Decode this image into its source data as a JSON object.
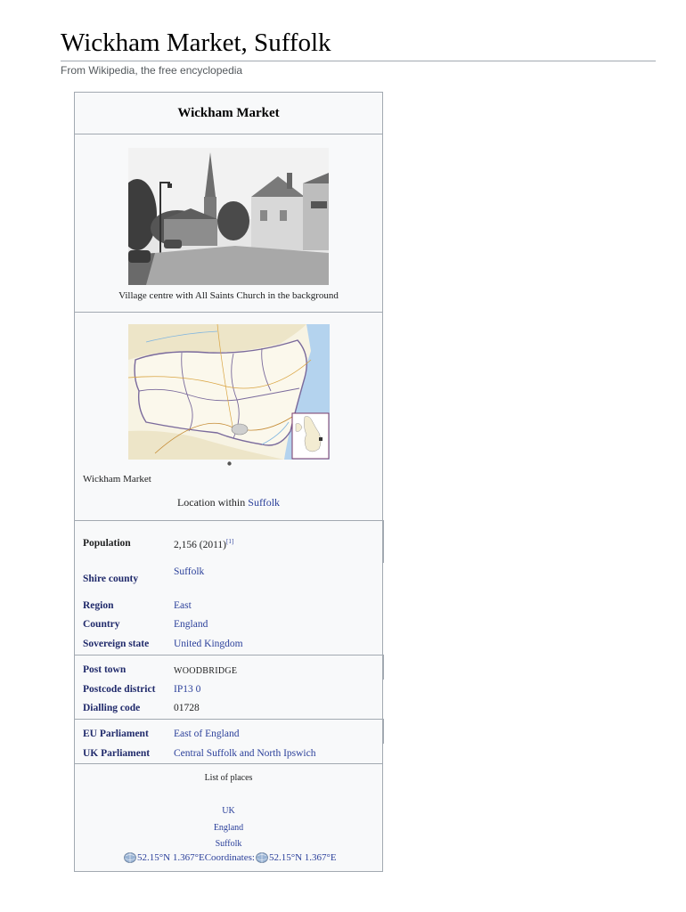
{
  "page": {
    "title": "Wickham Market, Suffolk",
    "tagline": "From Wikipedia, the free encyclopedia"
  },
  "infobox": {
    "title": "Wickham Market",
    "photo_caption": "Village centre with All Saints Church in the background",
    "map_marker_label": "Wickham Market",
    "map_caption_prefix": "Location within ",
    "map_caption_link": "Suffolk",
    "rows": {
      "population_label": "Population",
      "population_value": "2,156 (2011)",
      "population_ref": "[1]",
      "shire_county_label": "Shire county",
      "shire_county_value": "Suffolk",
      "region_label": "Region",
      "region_value": "East",
      "country_label": "Country",
      "country_value": "England",
      "sovereign_state_label": "Sovereign state",
      "sovereign_state_value": "United Kingdom",
      "post_town_label": "Post town",
      "post_town_value": "WOODBRIDGE",
      "postcode_district_label": "Postcode district",
      "postcode_district_value": "IP13 0",
      "dialling_code_label": "Dialling code",
      "dialling_code_value": "01728",
      "eu_parliament_label": "EU Parliament",
      "eu_parliament_value": "East of England",
      "uk_parliament_label": "UK Parliament",
      "uk_parliament_value": "Central Suffolk and North Ipswich"
    },
    "list_of_places": {
      "heading": "List of places",
      "items": [
        "UK",
        "England",
        "Suffolk"
      ]
    },
    "coordinates": {
      "first": "52.15°N 1.367°E",
      "label": "Coordinates: ",
      "second": "52.15°N 1.367°E"
    }
  },
  "icons": [
    "globe-icon",
    "location-dot-icon"
  ],
  "colors": {
    "link": "#2a3f9a",
    "border": "#a2a9b1",
    "infobox_bg": "#f8f9fa"
  }
}
